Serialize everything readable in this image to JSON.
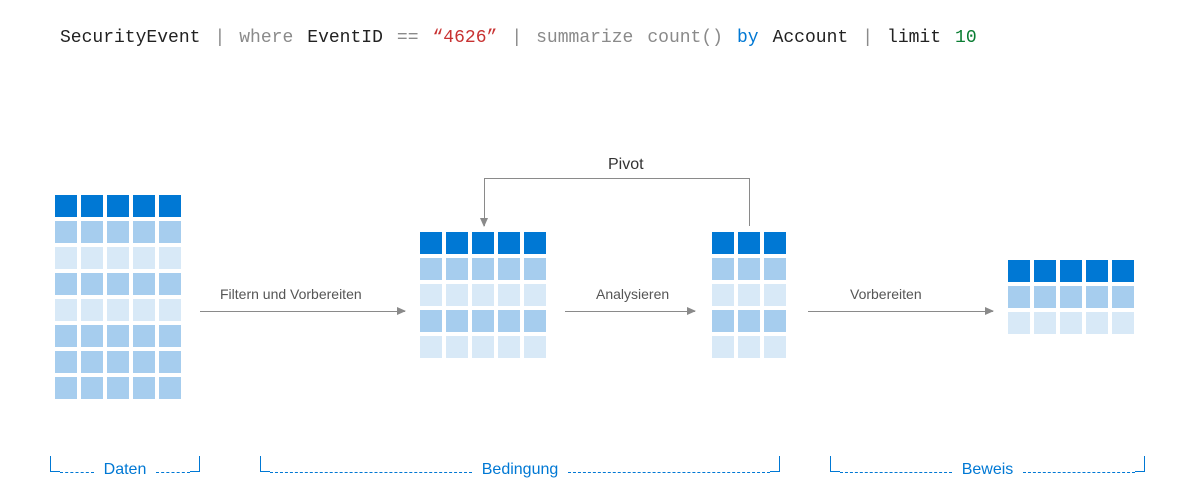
{
  "query": {
    "table": "SecurityEvent",
    "pipe": "|",
    "where": "where",
    "field": "EventID",
    "eq": "==",
    "value": "“4626”",
    "summarize": "summarize",
    "count": "count()",
    "by": "by",
    "groupfield": "Account",
    "limit": "limit",
    "limitn": "10"
  },
  "labels": {
    "pivot": "Pivot",
    "arrow1": "Filtern und Vorbereiten",
    "arrow2": "Analysieren",
    "arrow3": "Vorbereiten"
  },
  "sections": {
    "data": "Daten",
    "condition": "Bedingung",
    "evidence": "Beweis"
  },
  "grids": {
    "g1": {
      "cols": 5,
      "rows": 8
    },
    "g2": {
      "cols": 5,
      "rows": 5
    },
    "g3": {
      "cols": 3,
      "rows": 5
    },
    "g4": {
      "cols": 5,
      "rows": 3
    }
  },
  "colors": {
    "accent": "#0078d4",
    "gray": "#8a8a8a",
    "red": "#c83232",
    "green": "#0a7d33"
  }
}
